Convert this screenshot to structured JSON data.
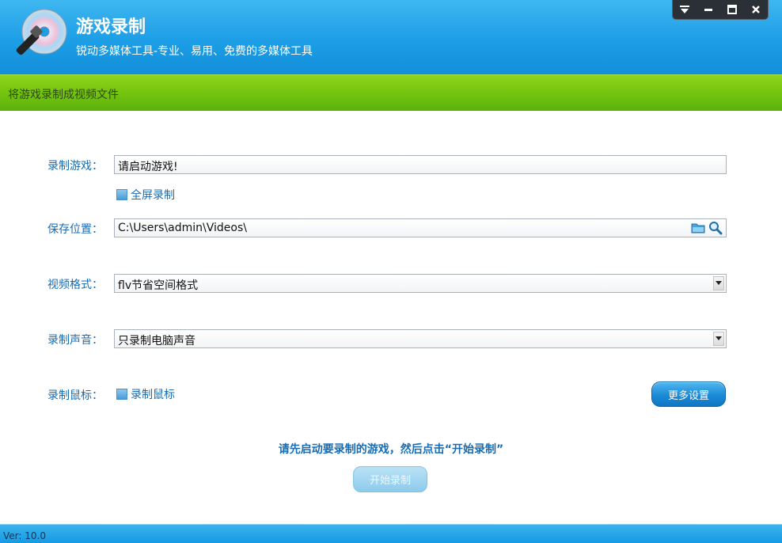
{
  "header": {
    "title": "游戏录制",
    "subtitle": "锐动多媒体工具-专业、易用、免费的多媒体工具",
    "logo_icon": "disc-with-torch-icon"
  },
  "window_controls": {
    "dropdown_icon": "menu-down-icon",
    "minimize_icon": "minimize-icon",
    "maximize_icon": "maximize-icon",
    "close_icon": "close-icon"
  },
  "band": {
    "text": "将游戏录制成视频文件"
  },
  "form": {
    "game_label": "录制游戏：",
    "game_value": "请启动游戏!",
    "fullscreen_label": "全屏录制",
    "fullscreen_checked": false,
    "save_label": "保存位置：",
    "save_value": "C:\\Users\\admin\\Videos\\",
    "format_label": "视频格式：",
    "format_value": "flv节省空间格式",
    "audio_label": "录制声音：",
    "audio_value": "只录制电脑声音",
    "mouse_label": "录制鼠标：",
    "mouse_checkbox_label": "录制鼠标",
    "mouse_checked": false,
    "more_settings": "更多设置"
  },
  "hint": "请先启动要录制的游戏，然后点击“开始录制”",
  "start_button": "开始录制",
  "footer": {
    "version": "Ver: 10.0"
  },
  "colors": {
    "header_blue": "#1c9ee6",
    "band_green": "#74c40f",
    "label_blue": "#1a6bb0"
  }
}
